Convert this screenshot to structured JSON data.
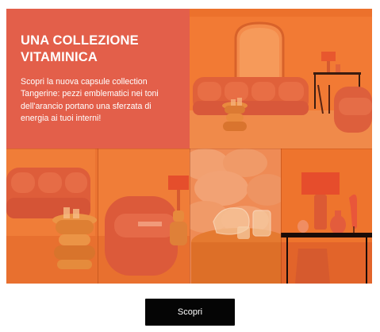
{
  "promo": {
    "title_line1": "UNA COLLEZIONE",
    "title_line2": "VITAMINICA",
    "description": "Scopri la nuova capsule collection Tangerine: pezzi emblematici nei toni dell'arancio portano una sferzata di energia ai tuoi interni!"
  },
  "cta": {
    "label": "Scopri"
  },
  "colors": {
    "promo_background": "#e35f4a",
    "accent_orange": "#ee6f2a",
    "button_background": "#050505",
    "button_text": "#ffffff"
  },
  "images": [
    {
      "name": "living-room-sofa-mirror-image"
    },
    {
      "name": "sofa-side-table-armchair-image"
    },
    {
      "name": "sofa-detail-glass-vase-image"
    },
    {
      "name": "console-table-lamp-bird-image"
    }
  ]
}
